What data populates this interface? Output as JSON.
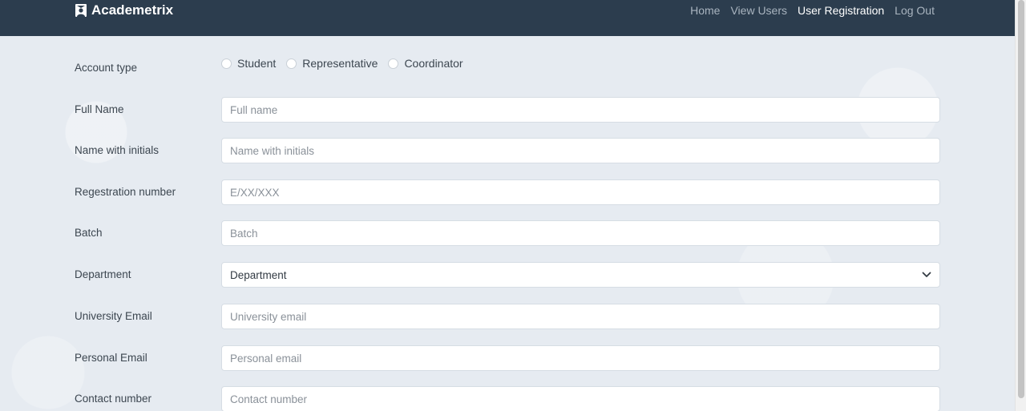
{
  "navbar": {
    "brand": "Academetrix",
    "links": [
      "Home",
      "View Users",
      "User Registration",
      "Log Out"
    ]
  },
  "form": {
    "account_type": {
      "label": "Account type",
      "options": [
        "Student",
        "Representative",
        "Coordinator"
      ]
    },
    "full_name": {
      "label": "Full Name",
      "placeholder": "Full name"
    },
    "name_initials": {
      "label": "Name with initials",
      "placeholder": "Name with initials"
    },
    "registration": {
      "label": "Regestration number",
      "placeholder": "E/XX/XXX"
    },
    "batch": {
      "label": "Batch",
      "placeholder": "Batch"
    },
    "department": {
      "label": "Department",
      "value": "Department"
    },
    "university_email": {
      "label": "University Email",
      "placeholder": "University email"
    },
    "personal_email": {
      "label": "Personal Email",
      "placeholder": "Personal email"
    },
    "contact": {
      "label": "Contact number",
      "placeholder": "Contact number"
    }
  }
}
